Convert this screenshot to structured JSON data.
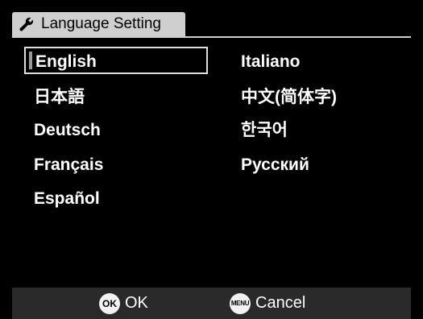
{
  "header": {
    "title": "Language Setting",
    "icon": "wrench-icon"
  },
  "languages": {
    "left": [
      "English",
      "日本語",
      "Deutsch",
      "Français",
      "Español"
    ],
    "right": [
      "Italiano",
      "中文(简体字)",
      "한국어",
      "Русский"
    ],
    "selected": "English"
  },
  "footer": {
    "ok_icon": "OK",
    "ok_label": "OK",
    "menu_icon": "MENU",
    "cancel_label": "Cancel"
  },
  "colors": {
    "background": "#000000",
    "header_tab": "#cfcfcf",
    "footer_bar": "#2a2a2a",
    "text": "#ffffff"
  }
}
